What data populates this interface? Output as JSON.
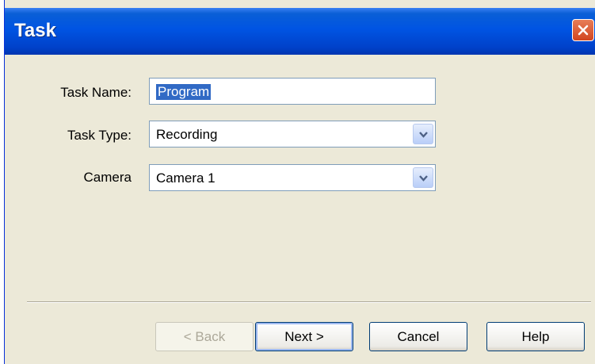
{
  "window": {
    "title": "Task"
  },
  "form": {
    "task_name": {
      "label": "Task Name:",
      "value": "Program"
    },
    "task_type": {
      "label": "Task Type:",
      "value": "Recording"
    },
    "camera": {
      "label": "Camera",
      "value": "Camera 1"
    }
  },
  "buttons": {
    "back": "< Back",
    "next": "Next >",
    "cancel": "Cancel",
    "help": "Help"
  },
  "colors": {
    "titlebar": "#0054e3",
    "dialog_bg": "#ece9d8",
    "selection": "#316ac5"
  }
}
